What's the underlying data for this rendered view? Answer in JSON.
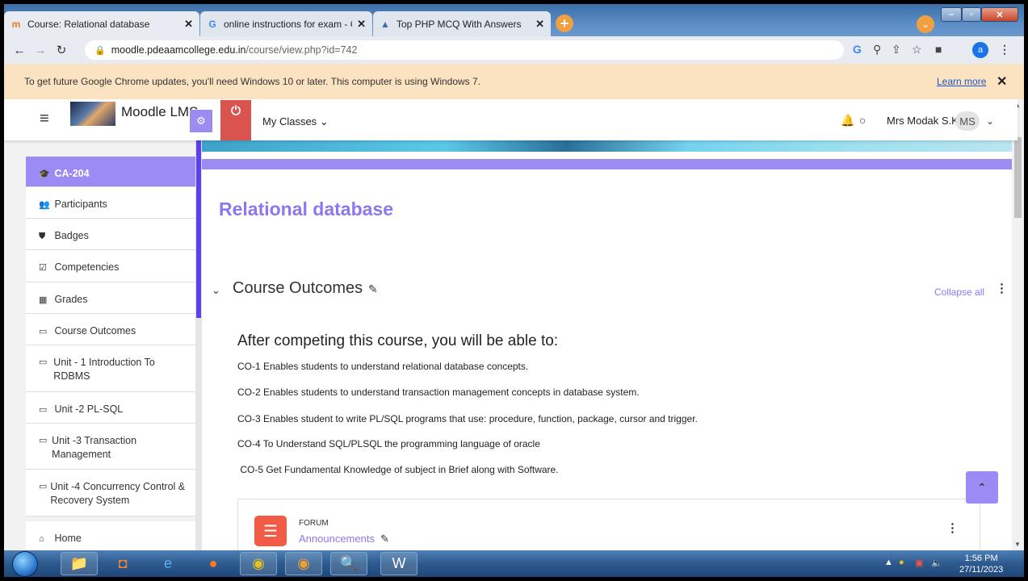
{
  "browser": {
    "tabs": [
      {
        "label": "Course: Relational database",
        "icon": "moodle-icon"
      },
      {
        "label": "online instructions for exam - Go",
        "icon": "google-icon"
      },
      {
        "label": "Top PHP MCQ With Answers",
        "icon": "site-icon"
      }
    ],
    "url_host": "moodle.pdeaamcollege.edu.in",
    "url_path": "/course/view.php?id=742",
    "profile_initial": "a"
  },
  "infobar": {
    "message": "To get future Google Chrome updates, you'll need Windows 10 or later. This computer is using Windows 7.",
    "link": "Learn more"
  },
  "navbar": {
    "site_name": "Moodle LMS.",
    "my_classes": "My Classes",
    "user_name": "Mrs Modak S.K",
    "user_initials": "MS"
  },
  "sidebar": {
    "items": [
      {
        "label": "CA-204",
        "icon": "graduation-cap-icon"
      },
      {
        "label": "Participants",
        "icon": "users-icon"
      },
      {
        "label": "Badges",
        "icon": "shield-icon"
      },
      {
        "label": "Competencies",
        "icon": "checkbox-icon"
      },
      {
        "label": "Grades",
        "icon": "table-icon"
      },
      {
        "label": "Course Outcomes",
        "icon": "folder-icon"
      },
      {
        "label": "Unit - 1 Introduction To RDBMS",
        "icon": "folder-icon"
      },
      {
        "label": "Unit -2 PL-SQL",
        "icon": "folder-icon"
      },
      {
        "label": "Unit -3 Transaction Management",
        "icon": "folder-icon"
      },
      {
        "label": "Unit -4 Concurrency Control & Recovery System",
        "icon": "folder-icon"
      },
      {
        "label": "Home",
        "icon": "home-icon"
      }
    ]
  },
  "course": {
    "title": "Relational database",
    "section_title": "Course Outcomes",
    "collapse_all": "Collapse all",
    "summary_heading": "After competing this course, you will be able to:",
    "outcomes": [
      "CO-1 Enables students to understand relational database concepts.",
      "CO-2 Enables students to understand transaction management concepts in database system.",
      "CO-3 Enables student to write PL/SQL programs that use: procedure, function, package, cursor and trigger.",
      "CO-4 To Understand SQL/PLSQL the programming language of oracle",
      " CO-5 Get Fundamental Knowledge of subject in Brief along with Software."
    ],
    "activity": {
      "type": "FORUM",
      "name": "Announcements"
    }
  },
  "taskbar": {
    "time": "1:56 PM",
    "date": "27/11/2023"
  },
  "colors": {
    "accent": "#9c8bf2",
    "title": "#8b78f0",
    "power": "#d9534f",
    "forum": "#f25b45"
  }
}
